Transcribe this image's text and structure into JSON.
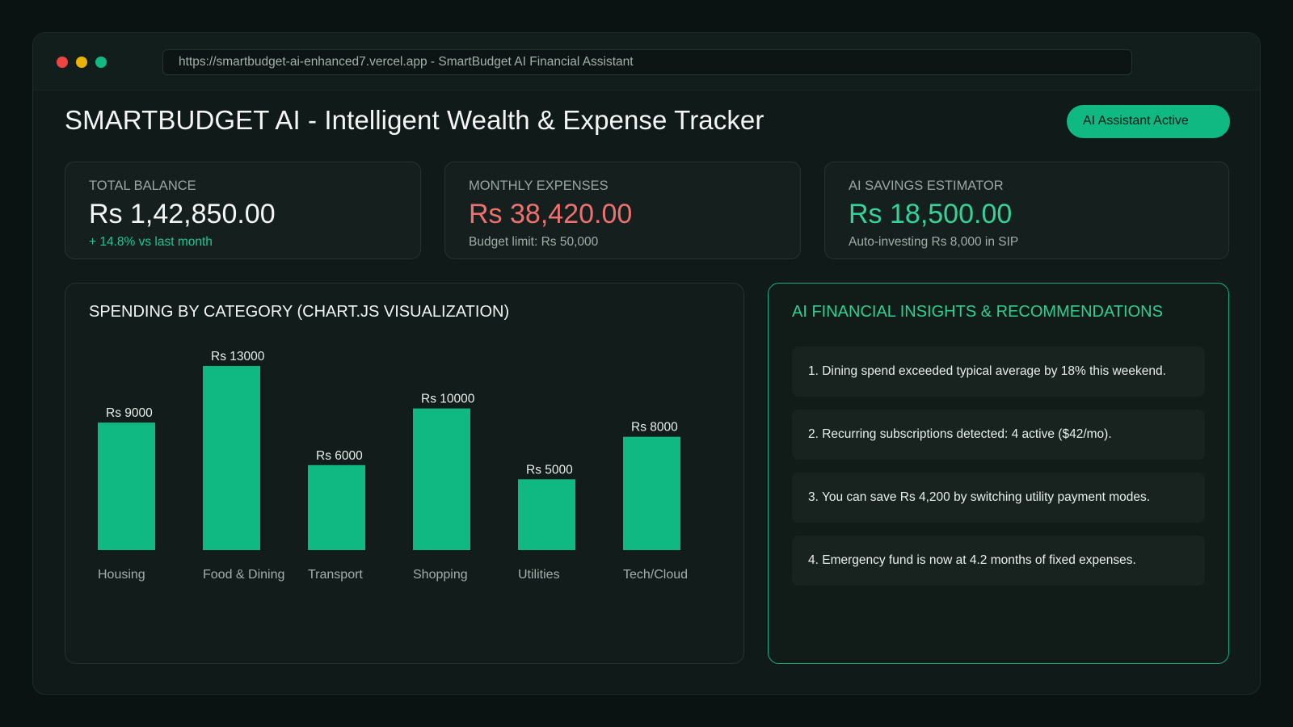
{
  "browser": {
    "url": "https://smartbudget-ai-enhanced7.vercel.app - SmartBudget AI Financial Assistant"
  },
  "header": {
    "title": "SMARTBUDGET AI - Intelligent Wealth & Expense Tracker",
    "ai_badge": "AI Assistant Active"
  },
  "cards": {
    "balance": {
      "label": "TOTAL BALANCE",
      "value": "Rs 1,42,850.00",
      "sub": "+ 14.8% vs last month"
    },
    "expenses": {
      "label": "MONTHLY EXPENSES",
      "value": "Rs 38,420.00",
      "sub": "Budget limit: Rs 50,000"
    },
    "savings": {
      "label": "AI SAVINGS ESTIMATOR",
      "value": "Rs 18,500.00",
      "sub": "Auto-investing Rs 8,000 in SIP"
    }
  },
  "chart_panel": {
    "title": "SPENDING BY CATEGORY (CHART.JS VISUALIZATION)"
  },
  "chart_data": {
    "type": "bar",
    "categories": [
      "Housing",
      "Food & Dining",
      "Transport",
      "Shopping",
      "Utilities",
      "Tech/Cloud"
    ],
    "values": [
      9000,
      13000,
      6000,
      10000,
      5000,
      8000
    ],
    "value_label_prefix": "Rs ",
    "bar_color": "#10b981",
    "grid": false,
    "legend": "none",
    "title": "SPENDING BY CATEGORY (CHART.JS VISUALIZATION)",
    "xlabel": "",
    "ylabel": ""
  },
  "insights_panel": {
    "title": "AI FINANCIAL INSIGHTS & RECOMMENDATIONS",
    "items": [
      "1. Dining spend exceeded typical average by 18% this weekend.",
      "2. Recurring subscriptions detected: 4 active ($42/mo).",
      "3. You can save Rs 4,200 by switching utility payment modes.",
      "4. Emergency fund is now at 4.2 months of fixed expenses."
    ]
  },
  "colors": {
    "accent": "#10b981",
    "expense_red": "#f07070",
    "savings_green": "#34d399",
    "window_controls": [
      "#ef4444",
      "#eab308",
      "#10b981"
    ]
  }
}
